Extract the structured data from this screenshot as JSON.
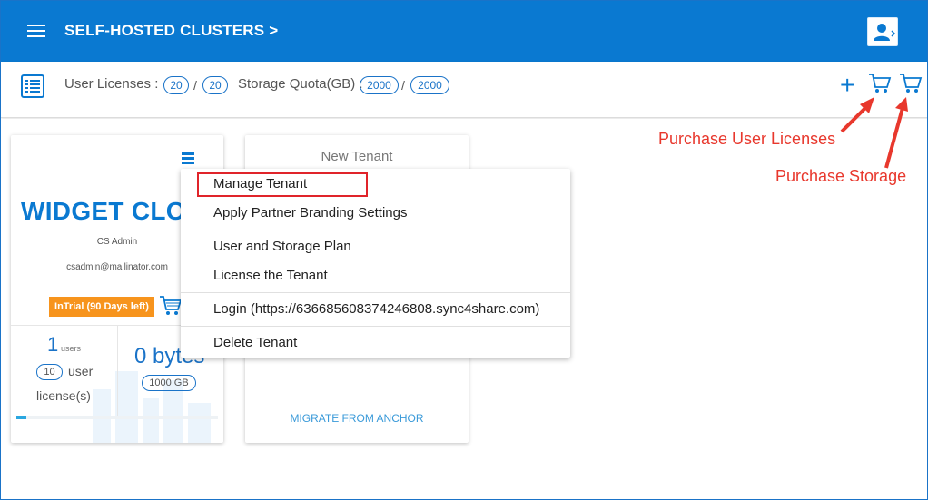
{
  "header": {
    "title": "SELF-HOSTED CLUSTERS >"
  },
  "subbar": {
    "user_licenses_label": "User Licenses :",
    "user_licenses_used": "20",
    "user_licenses_total": "20",
    "storage_label": "Storage Quota(GB) :",
    "storage_used": "2000",
    "storage_total": "2000",
    "separator": "/",
    "add_symbol": "+"
  },
  "tenant_card": {
    "name": "WIDGET CLOUD",
    "admin_name": "CS Admin",
    "admin_email": "csadmin@mailinator.com",
    "trial_badge": "InTrial (90 Days left)",
    "user_count": "1",
    "users_word": "users",
    "license_count": "10",
    "license_text_1": "user",
    "license_text_2": "license(s)",
    "storage_used": "0 bytes",
    "storage_quota": "1000 GB",
    "usage_fraction": 0.05
  },
  "new_tenant_card": {
    "title": "New Tenant",
    "migrate_link": "MIGRATE FROM ANCHOR"
  },
  "dropdown": {
    "items": [
      "Manage Tenant",
      "Apply Partner Branding Settings",
      "User and Storage Plan",
      "License the Tenant",
      "Login (https://636685608374246808.sync4share.com)",
      "Delete Tenant"
    ]
  },
  "annotations": {
    "purchase_user_licenses": "Purchase User Licenses",
    "purchase_storage": "Purchase Storage"
  },
  "colors": {
    "brand_blue": "#0a79d1",
    "annotation_red": "#e8382d",
    "trial_orange": "#f7941d"
  },
  "icons": {
    "menu": "hamburger-icon",
    "user": "user-profile-icon",
    "list": "list-icon",
    "cart": "shopping-cart-icon"
  }
}
